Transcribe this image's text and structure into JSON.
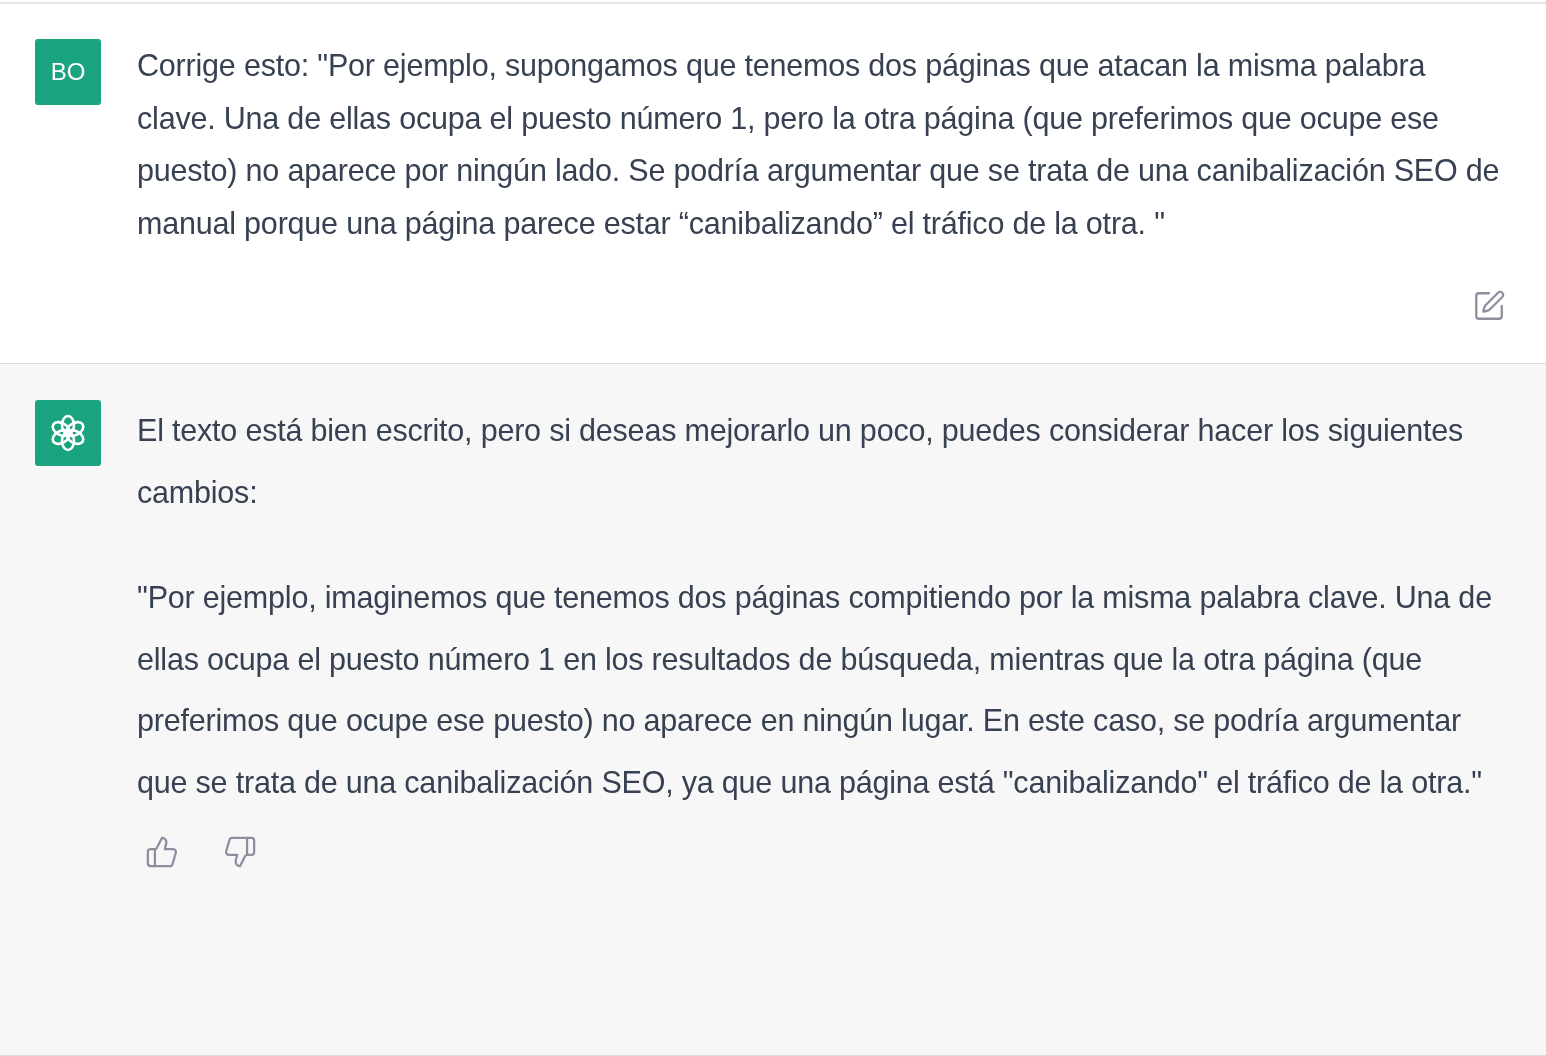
{
  "messages": [
    {
      "kind": "user",
      "avatar": "BO",
      "paragraphs": [
        "Corrige esto: \"Por ejemplo, supongamos que tenemos dos páginas que atacan la misma palabra clave. Una de ellas ocupa el puesto número 1, pero la otra página (que preferimos que ocupe ese puesto) no aparece por ningún lado. Se podría argumentar que se trata de una canibalización SEO de manual porque una página parece estar “canibalizando” el tráfico de la otra. \""
      ]
    },
    {
      "kind": "assistant",
      "paragraphs": [
        "El texto está bien escrito, pero si deseas mejorarlo un poco, puedes considerar hacer los siguientes cambios:",
        "\"Por ejemplo, imaginemos que tenemos dos páginas compitiendo por la misma palabra clave. Una de ellas ocupa el puesto número 1 en los resultados de búsqueda, mientras que la otra página (que preferimos que ocupe ese puesto) no aparece en ningún lugar. En este caso, se podría argumentar que se trata de una canibalización SEO, ya que una página está \"canibalizando\" el tráfico de la otra.\""
      ]
    }
  ]
}
